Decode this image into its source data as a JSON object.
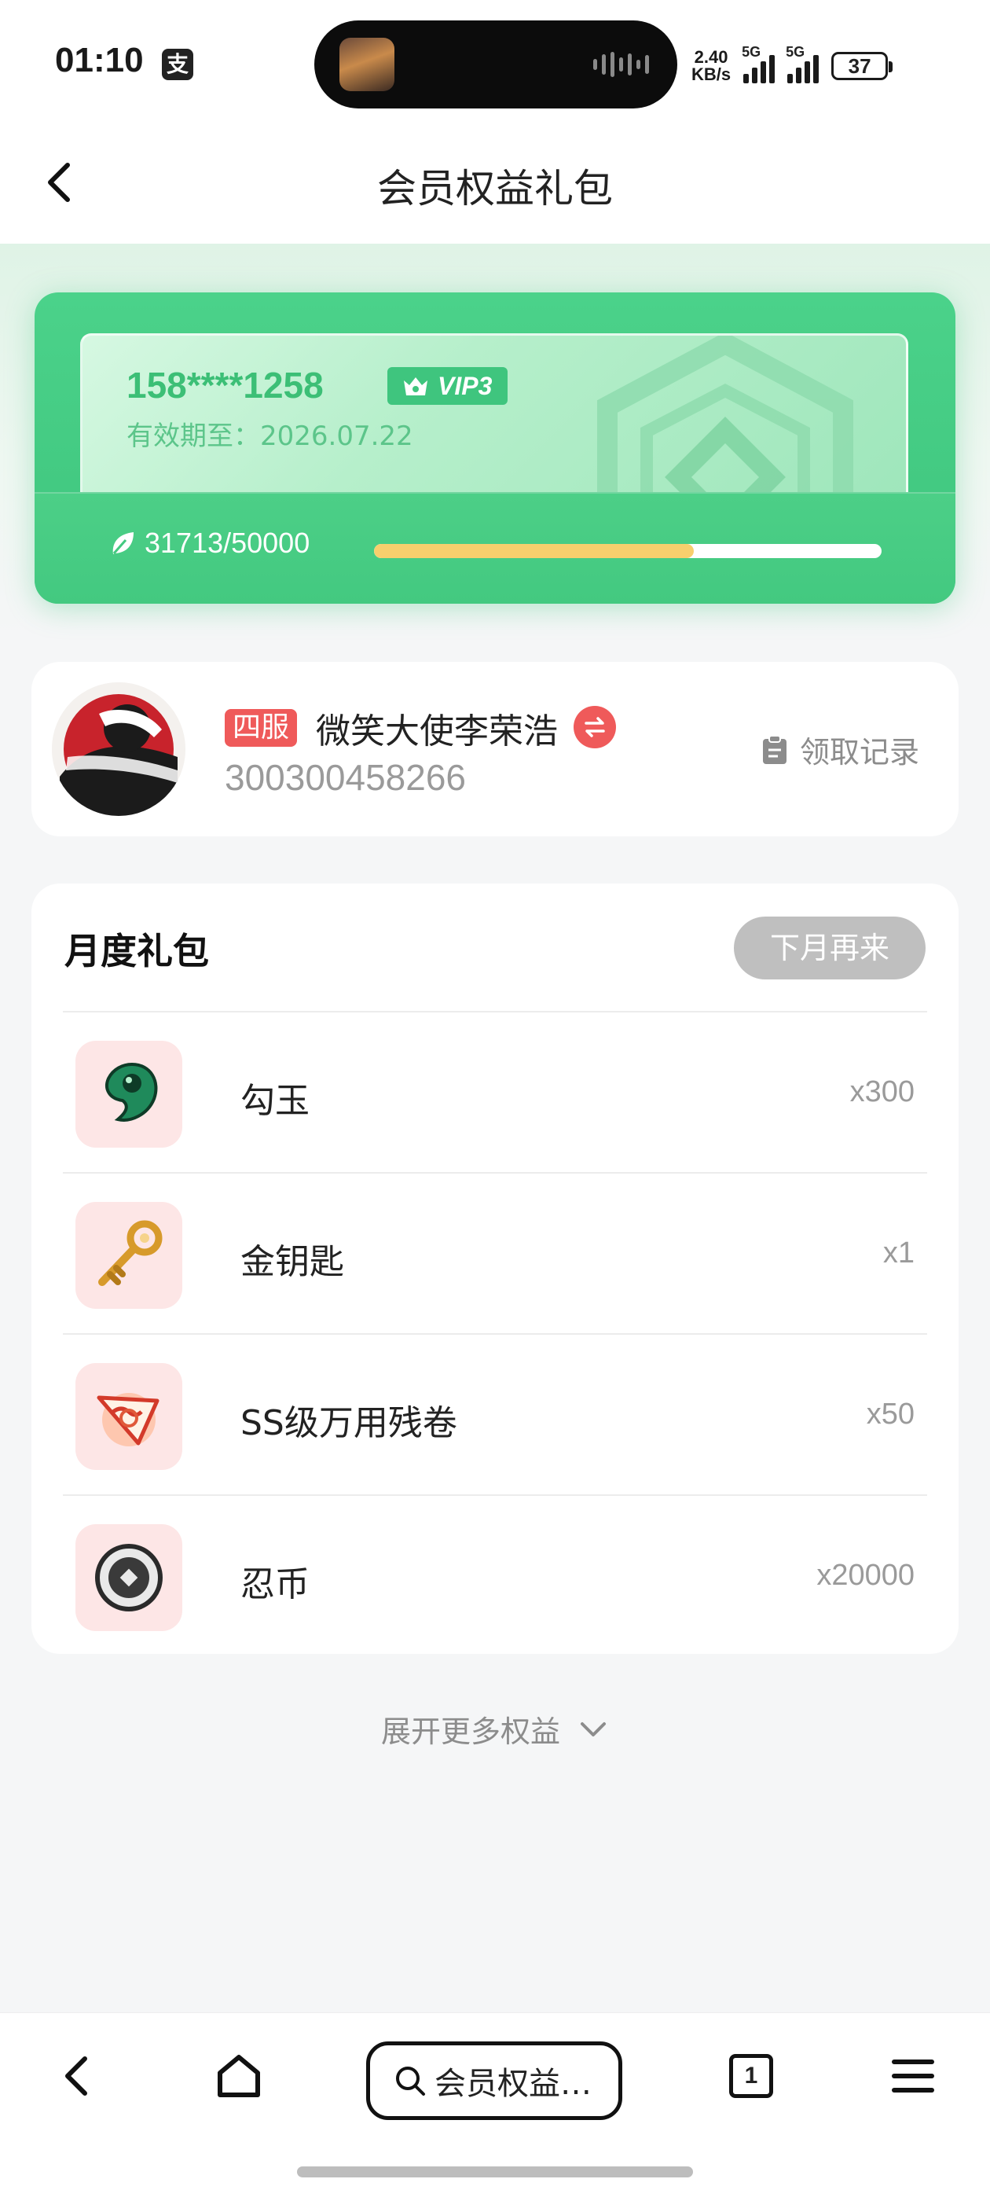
{
  "status_bar": {
    "time": "01:10",
    "app_icon_glyph": "支",
    "network_speed_value": "2.40",
    "network_speed_unit": "KB/s",
    "signal1_label": "5G",
    "signal2_label": "5G",
    "battery": "37"
  },
  "header": {
    "title": "会员权益礼包",
    "back_icon": "chevron-left-icon"
  },
  "vip_card": {
    "phone": "158****1258",
    "level": "VIP3",
    "expiry_label": "有效期至：2026.07.22",
    "points_text": "31713/50000",
    "points_current": 31713,
    "points_total": 50000,
    "progress_fraction": 0.63,
    "colors": {
      "primary": "#3ec57d",
      "progress": "#f7cf6d"
    }
  },
  "user": {
    "server_tag": "四服",
    "name": "微笑大使李荣浩",
    "id": "300300458266",
    "record_link": "领取记录"
  },
  "gift_section": {
    "title": "月度礼包",
    "button_label": "下月再来",
    "items": [
      {
        "name": "勾玉",
        "qty": "x300",
        "icon": "magatama-icon"
      },
      {
        "name": "金钥匙",
        "qty": "x1",
        "icon": "gold-key-icon"
      },
      {
        "name": "SS级万用残卷",
        "qty": "x50",
        "icon": "scroll-icon"
      },
      {
        "name": "忍币",
        "qty": "x20000",
        "icon": "coin-icon"
      }
    ]
  },
  "expand_more": "展开更多权益",
  "browser_bar": {
    "address_text": "会员权益…",
    "tab_count": "1"
  }
}
